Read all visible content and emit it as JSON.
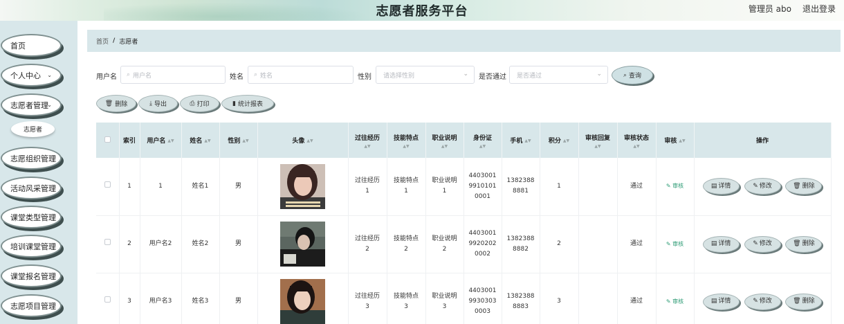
{
  "header": {
    "title": "志愿者服务平台",
    "user": "管理员 abo",
    "logout": "退出登录"
  },
  "sidebar": {
    "items": [
      {
        "label": "首页",
        "has_chevron": false
      },
      {
        "label": "个人中心",
        "has_chevron": true
      },
      {
        "label": "志愿者管理",
        "has_chevron": true
      },
      {
        "label": "志愿组织管理",
        "has_chevron": false
      },
      {
        "label": "活动风采管理",
        "has_chevron": false
      },
      {
        "label": "课堂类型管理",
        "has_chevron": false
      },
      {
        "label": "培训课堂管理",
        "has_chevron": false
      },
      {
        "label": "课堂报名管理",
        "has_chevron": false
      },
      {
        "label": "志愿项目管理",
        "has_chevron": false
      }
    ],
    "sub_item": "志愿者",
    "chevron_glyph": "⌄"
  },
  "breadcrumb": {
    "home": "首页",
    "separator": "/",
    "current": "志愿者"
  },
  "search": {
    "username_label": "用户名",
    "username_placeholder": "用户名",
    "name_label": "姓名",
    "name_placeholder": "姓名",
    "gender_label": "性别",
    "gender_placeholder": "请选择性别",
    "approved_label": "是否通过",
    "approved_placeholder": "是否通过",
    "query_label": "查询",
    "search_icon": "⌕",
    "dropdown_icon": "⌄"
  },
  "actions": {
    "delete": "删除",
    "export": "导出",
    "print": "打印",
    "stats": "统计报表",
    "delete_icon": "🗑",
    "export_icon": "⤓",
    "print_icon": "⎙",
    "stats_icon": "▮"
  },
  "table": {
    "headers": {
      "index": "索引",
      "username": "用户名",
      "name": "姓名",
      "gender": "性别",
      "avatar": "头像",
      "experience": "过往经历",
      "skills": "技能特点",
      "job": "职业说明",
      "idcard": "身份证",
      "phone": "手机",
      "points": "积分",
      "review_reply": "审核回复",
      "review_status": "审核状态",
      "review": "审核",
      "ops": "操作"
    },
    "sort_glyph": "▲▼",
    "review_link": "审核",
    "review_icon": "✎",
    "op_detail": "详情",
    "op_edit": "修改",
    "op_delete": "删除",
    "op_detail_icon": "▤",
    "op_edit_icon": "✎",
    "op_delete_icon": "🗑",
    "rows": [
      {
        "index": "1",
        "username": "1",
        "name": "姓名1",
        "gender": "男",
        "experience_1": "过往经历",
        "experience_2": "1",
        "skills_1": "技能特点",
        "skills_2": "1",
        "job_1": "职业说明",
        "job_2": "1",
        "id_1": "4403001",
        "id_2": "9910101",
        "id_3": "0001",
        "phone_1": "1382388",
        "phone_2": "8881",
        "points": "1",
        "review_reply": "",
        "review_status": "通过",
        "avatar_colors": [
          "#3a2522",
          "#e9c8b8",
          "#1a1414"
        ]
      },
      {
        "index": "2",
        "username": "用户名2",
        "name": "姓名2",
        "gender": "男",
        "experience_1": "过往经历",
        "experience_2": "2",
        "skills_1": "技能特点",
        "skills_2": "2",
        "job_1": "职业说明",
        "job_2": "2",
        "id_1": "4403001",
        "id_2": "9920202",
        "id_3": "0002",
        "phone_1": "1382388",
        "phone_2": "8882",
        "points": "2",
        "review_reply": "",
        "review_status": "通过",
        "avatar_colors": [
          "#55605a",
          "#d9c2b2",
          "#141414"
        ]
      },
      {
        "index": "3",
        "username": "用户名3",
        "name": "姓名3",
        "gender": "男",
        "experience_1": "过往经历",
        "experience_2": "3",
        "skills_1": "技能特点",
        "skills_2": "3",
        "job_1": "职业说明",
        "job_2": "3",
        "id_1": "4403001",
        "id_2": "9930303",
        "id_3": "0003",
        "phone_1": "1382388",
        "phone_2": "8883",
        "points": "3",
        "review_reply": "",
        "review_status": "通过",
        "avatar_colors": [
          "#8a5b3e",
          "#edd0bd",
          "#1d1412"
        ]
      }
    ]
  }
}
